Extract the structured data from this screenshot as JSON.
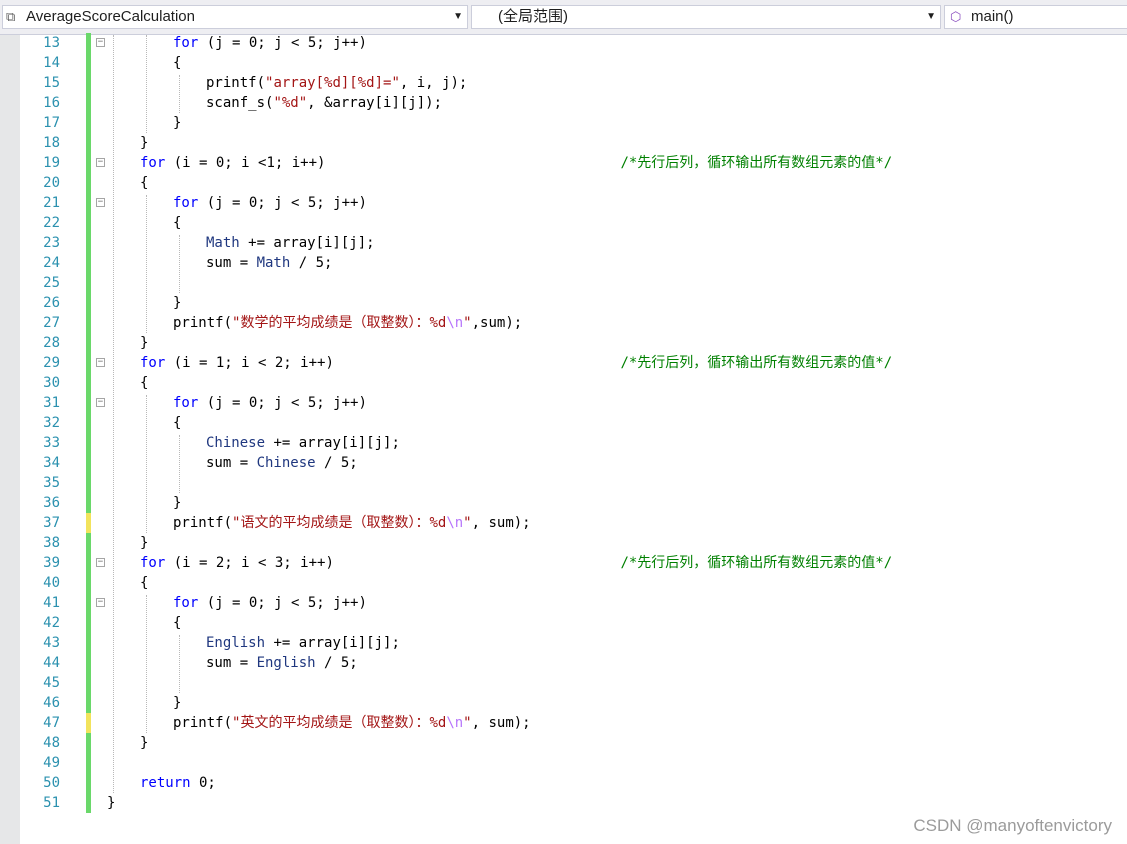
{
  "navbar": {
    "project": "AverageScoreCalculation",
    "scope": "(全局范围)",
    "member": "main()"
  },
  "watermark": "CSDN @manyoftenvictory",
  "lines": [
    {
      "n": "13",
      "ind": 2,
      "fold": true,
      "chg": "saved",
      "toks": [
        [
          "k",
          "for"
        ],
        [
          "p",
          " (j = 0; j < 5; j++)"
        ]
      ]
    },
    {
      "n": "14",
      "ind": 2,
      "fold": false,
      "chg": "saved",
      "toks": [
        [
          "p",
          "{"
        ]
      ]
    },
    {
      "n": "15",
      "ind": 3,
      "fold": false,
      "chg": "saved",
      "toks": [
        [
          "p",
          "printf("
        ],
        [
          "s",
          "\"array[%d][%d]=\""
        ],
        [
          "p",
          ", i, j);"
        ]
      ]
    },
    {
      "n": "16",
      "ind": 3,
      "fold": false,
      "chg": "saved",
      "toks": [
        [
          "p",
          "scanf_s("
        ],
        [
          "s",
          "\"%d\""
        ],
        [
          "p",
          ", &array[i][j]);"
        ]
      ]
    },
    {
      "n": "17",
      "ind": 2,
      "fold": false,
      "chg": "saved",
      "toks": [
        [
          "p",
          "}"
        ]
      ]
    },
    {
      "n": "18",
      "ind": 1,
      "fold": false,
      "chg": "saved",
      "toks": [
        [
          "p",
          "}"
        ]
      ]
    },
    {
      "n": "19",
      "ind": 1,
      "fold": true,
      "chg": "saved",
      "toks": [
        [
          "k",
          "for"
        ],
        [
          "p",
          " (i = 0; i <1; i++)                                   "
        ],
        [
          "c",
          "/*先行后列，循环输出所有数组元素的值*/"
        ]
      ]
    },
    {
      "n": "20",
      "ind": 1,
      "fold": false,
      "chg": "saved",
      "toks": [
        [
          "p",
          "{"
        ]
      ]
    },
    {
      "n": "21",
      "ind": 2,
      "fold": true,
      "chg": "saved",
      "toks": [
        [
          "k",
          "for"
        ],
        [
          "p",
          " (j = 0; j < 5; j++)"
        ]
      ]
    },
    {
      "n": "22",
      "ind": 2,
      "fold": false,
      "chg": "saved",
      "toks": [
        [
          "p",
          "{"
        ]
      ]
    },
    {
      "n": "23",
      "ind": 3,
      "fold": false,
      "chg": "saved",
      "toks": [
        [
          "v",
          "Math"
        ],
        [
          "p",
          " += array[i][j];"
        ]
      ]
    },
    {
      "n": "24",
      "ind": 3,
      "fold": false,
      "chg": "saved",
      "toks": [
        [
          "p",
          "sum = "
        ],
        [
          "v",
          "Math"
        ],
        [
          "p",
          " / 5;"
        ]
      ]
    },
    {
      "n": "25",
      "ind": 3,
      "fold": false,
      "chg": "saved",
      "toks": []
    },
    {
      "n": "26",
      "ind": 2,
      "fold": false,
      "chg": "saved",
      "toks": [
        [
          "p",
          "}"
        ]
      ]
    },
    {
      "n": "27",
      "ind": 2,
      "fold": false,
      "chg": "saved",
      "toks": [
        [
          "p",
          "printf("
        ],
        [
          "s",
          "\"数学的平均成绩是（取整数）：%d"
        ],
        [
          "e",
          "\\n"
        ],
        [
          "s",
          "\""
        ],
        [
          "p",
          ",sum);"
        ]
      ]
    },
    {
      "n": "28",
      "ind": 1,
      "fold": false,
      "chg": "saved",
      "toks": [
        [
          "p",
          "}"
        ]
      ]
    },
    {
      "n": "29",
      "ind": 1,
      "fold": true,
      "chg": "saved",
      "toks": [
        [
          "k",
          "for"
        ],
        [
          "p",
          " (i = 1; i < 2; i++)                                  "
        ],
        [
          "c",
          "/*先行后列，循环输出所有数组元素的值*/"
        ]
      ]
    },
    {
      "n": "30",
      "ind": 1,
      "fold": false,
      "chg": "saved",
      "toks": [
        [
          "p",
          "{"
        ]
      ]
    },
    {
      "n": "31",
      "ind": 2,
      "fold": true,
      "chg": "saved",
      "toks": [
        [
          "k",
          "for"
        ],
        [
          "p",
          " (j = 0; j < 5; j++)"
        ]
      ]
    },
    {
      "n": "32",
      "ind": 2,
      "fold": false,
      "chg": "saved",
      "toks": [
        [
          "p",
          "{"
        ]
      ]
    },
    {
      "n": "33",
      "ind": 3,
      "fold": false,
      "chg": "saved",
      "toks": [
        [
          "v",
          "Chinese"
        ],
        [
          "p",
          " += array[i][j];"
        ]
      ]
    },
    {
      "n": "34",
      "ind": 3,
      "fold": false,
      "chg": "saved",
      "toks": [
        [
          "p",
          "sum = "
        ],
        [
          "v",
          "Chinese"
        ],
        [
          "p",
          " / 5;"
        ]
      ]
    },
    {
      "n": "35",
      "ind": 3,
      "fold": false,
      "chg": "saved",
      "toks": []
    },
    {
      "n": "36",
      "ind": 2,
      "fold": false,
      "chg": "saved",
      "toks": [
        [
          "p",
          "}"
        ]
      ]
    },
    {
      "n": "37",
      "ind": 2,
      "fold": false,
      "chg": "unsaved",
      "toks": [
        [
          "p",
          "printf("
        ],
        [
          "s",
          "\"语文的平均成绩是（取整数）：%d"
        ],
        [
          "e",
          "\\n"
        ],
        [
          "s",
          "\""
        ],
        [
          "p",
          ", sum);"
        ]
      ]
    },
    {
      "n": "38",
      "ind": 1,
      "fold": false,
      "chg": "saved",
      "toks": [
        [
          "p",
          "}"
        ]
      ]
    },
    {
      "n": "39",
      "ind": 1,
      "fold": true,
      "chg": "saved",
      "toks": [
        [
          "k",
          "for"
        ],
        [
          "p",
          " (i = 2; i < 3; i++)                                  "
        ],
        [
          "c",
          "/*先行后列，循环输出所有数组元素的值*/"
        ]
      ]
    },
    {
      "n": "40",
      "ind": 1,
      "fold": false,
      "chg": "saved",
      "toks": [
        [
          "p",
          "{"
        ]
      ]
    },
    {
      "n": "41",
      "ind": 2,
      "fold": true,
      "chg": "saved",
      "toks": [
        [
          "k",
          "for"
        ],
        [
          "p",
          " (j = 0; j < 5; j++)"
        ]
      ]
    },
    {
      "n": "42",
      "ind": 2,
      "fold": false,
      "chg": "saved",
      "toks": [
        [
          "p",
          "{"
        ]
      ]
    },
    {
      "n": "43",
      "ind": 3,
      "fold": false,
      "chg": "saved",
      "toks": [
        [
          "v",
          "English"
        ],
        [
          "p",
          " += array[i][j];"
        ]
      ]
    },
    {
      "n": "44",
      "ind": 3,
      "fold": false,
      "chg": "saved",
      "toks": [
        [
          "p",
          "sum = "
        ],
        [
          "v",
          "English"
        ],
        [
          "p",
          " / 5;"
        ]
      ]
    },
    {
      "n": "45",
      "ind": 3,
      "fold": false,
      "chg": "saved",
      "toks": []
    },
    {
      "n": "46",
      "ind": 2,
      "fold": false,
      "chg": "saved",
      "toks": [
        [
          "p",
          "}"
        ]
      ]
    },
    {
      "n": "47",
      "ind": 2,
      "fold": false,
      "chg": "unsaved",
      "toks": [
        [
          "p",
          "printf("
        ],
        [
          "s",
          "\"英文的平均成绩是（取整数）：%d"
        ],
        [
          "e",
          "\\n"
        ],
        [
          "s",
          "\""
        ],
        [
          "p",
          ", sum);"
        ]
      ]
    },
    {
      "n": "48",
      "ind": 1,
      "fold": false,
      "chg": "saved",
      "toks": [
        [
          "p",
          "}"
        ]
      ]
    },
    {
      "n": "49",
      "ind": 1,
      "fold": false,
      "chg": "saved",
      "toks": []
    },
    {
      "n": "50",
      "ind": 1,
      "fold": false,
      "chg": "saved",
      "toks": [
        [
          "k",
          "return"
        ],
        [
          "p",
          " 0;"
        ]
      ]
    },
    {
      "n": "51",
      "ind": 0,
      "fold": false,
      "chg": "saved",
      "toks": [
        [
          "p",
          "}"
        ]
      ]
    }
  ]
}
